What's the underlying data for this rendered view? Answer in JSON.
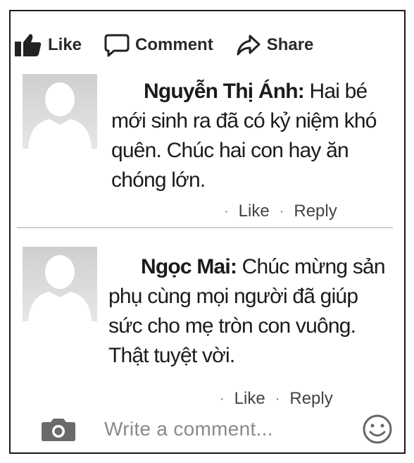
{
  "actions": {
    "like": "Like",
    "comment": "Comment",
    "share": "Share"
  },
  "comments": [
    {
      "author": "Nguyễn Thị Ánh:",
      "text": " Hai bé mới sinh ra đã có kỷ niệm khó quên. Chúc hai con hay ăn chóng lớn.",
      "like": "Like",
      "reply": "Reply"
    },
    {
      "author": "Ngọc Mai:",
      "text": " Chúc mừng sản phụ cùng mọi người đã giúp sức cho mẹ tròn con vuông. Thật tuyệt vời.",
      "like": "Like",
      "reply": "Reply"
    }
  ],
  "composer": {
    "placeholder": "Write a comment..."
  },
  "icons": [
    "thumbs-up-icon",
    "comment-icon",
    "share-icon",
    "camera-icon",
    "smiley-icon",
    "avatar-placeholder"
  ]
}
